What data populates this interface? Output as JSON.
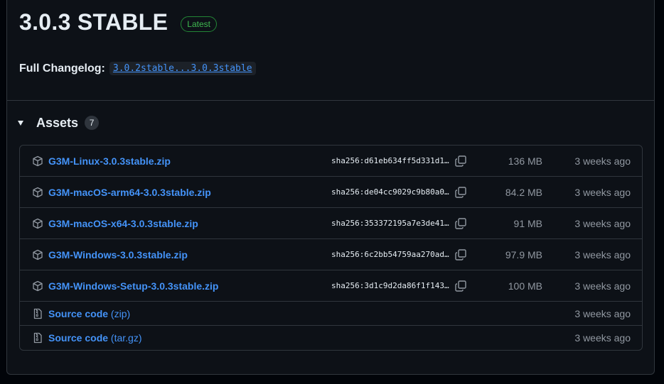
{
  "release": {
    "title": "3.0.3 STABLE",
    "badge": "Latest",
    "changelog_label": "Full Changelog:",
    "changelog_link": "3.0.2stable...3.0.3stable"
  },
  "assets": {
    "title": "Assets",
    "count": "7",
    "items": [
      {
        "name": "G3M-Linux-3.0.3stable.zip",
        "sha": "sha256:d61eb634ff5d331d1…",
        "size": "136 MB",
        "date": "3 weeks ago",
        "icon": "package-icon"
      },
      {
        "name": "G3M-macOS-arm64-3.0.3stable.zip",
        "sha": "sha256:de04cc9029c9b80a0…",
        "size": "84.2 MB",
        "date": "3 weeks ago",
        "icon": "package-icon"
      },
      {
        "name": "G3M-macOS-x64-3.0.3stable.zip",
        "sha": "sha256:353372195a7e3de41…",
        "size": "91 MB",
        "date": "3 weeks ago",
        "icon": "package-icon"
      },
      {
        "name": "G3M-Windows-3.0.3stable.zip",
        "sha": "sha256:6c2bb54759aa270ad…",
        "size": "97.9 MB",
        "date": "3 weeks ago",
        "icon": "package-icon"
      },
      {
        "name": "G3M-Windows-Setup-3.0.3stable.zip",
        "sha": "sha256:3d1c9d2da86f1f143…",
        "size": "100 MB",
        "date": "3 weeks ago",
        "icon": "package-icon"
      }
    ],
    "sources": [
      {
        "name": "Source code",
        "suffix": "(zip)",
        "date": "3 weeks ago",
        "icon": "file-zip-icon"
      },
      {
        "name": "Source code",
        "suffix": "(tar.gz)",
        "date": "3 weeks ago",
        "icon": "file-zip-icon"
      }
    ]
  },
  "colors": {
    "background": "#0d1117",
    "border": "#30363d",
    "link": "#4493f8",
    "muted": "#9198a1",
    "latest_green": "#3fb950"
  }
}
